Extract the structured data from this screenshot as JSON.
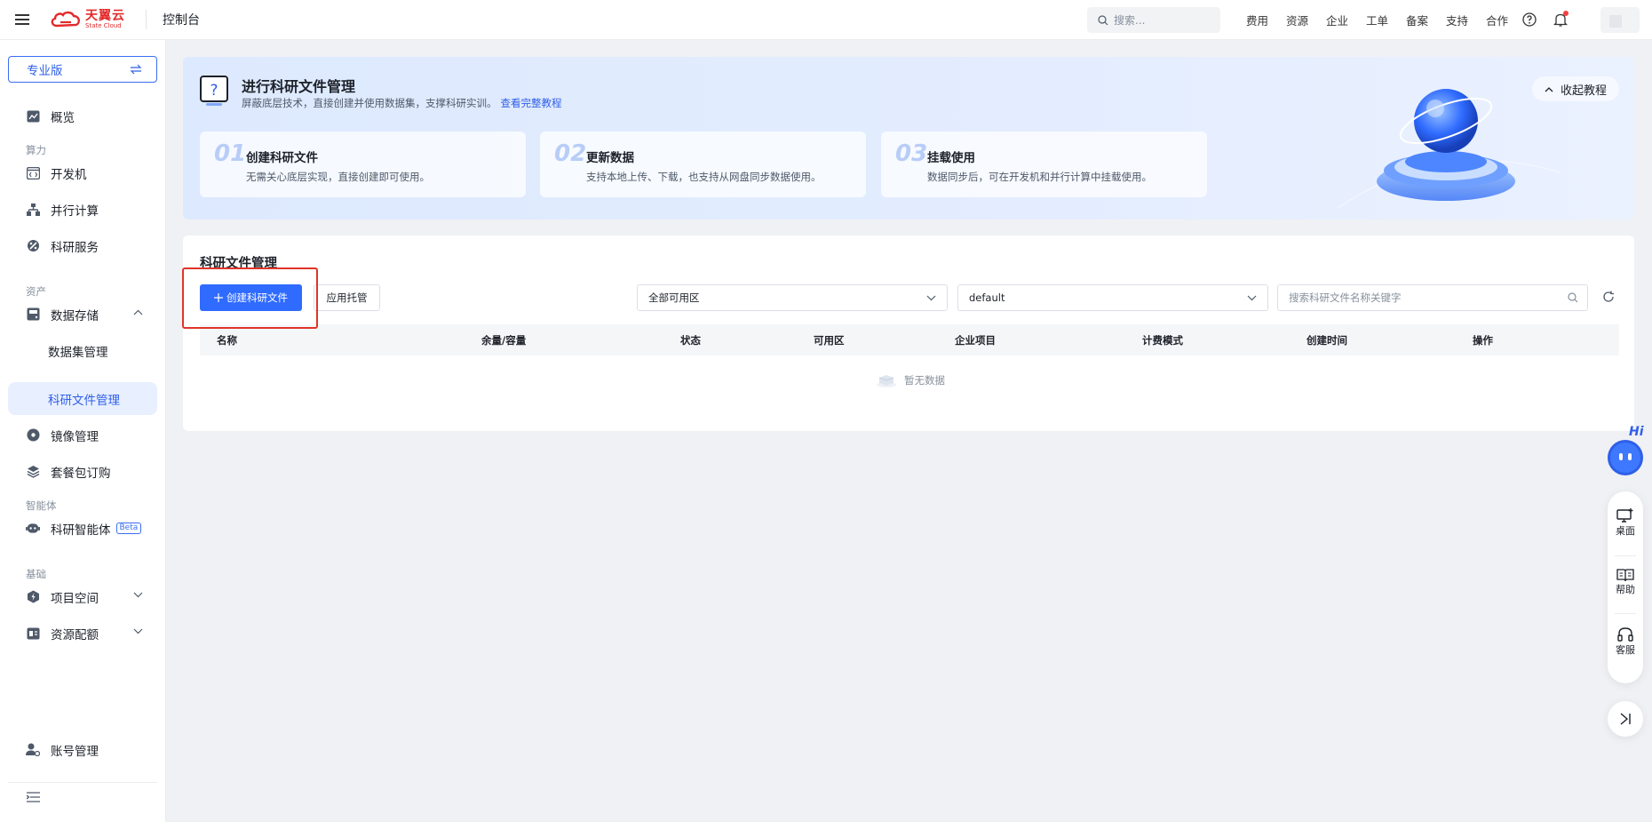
{
  "topbar": {
    "brand_cn": "天翼云",
    "brand_en": "State Cloud",
    "console_title": "控制台",
    "search_placeholder": "搜索...",
    "nav": [
      "费用",
      "资源",
      "企业",
      "工单",
      "备案",
      "支持",
      "合作"
    ]
  },
  "sidebar": {
    "edition_label": "专业版",
    "overview": "概览",
    "group_compute": "算力",
    "dev_machine": "开发机",
    "parallel": "并行计算",
    "research_service": "科研服务",
    "group_assets": "资产",
    "data_storage": "数据存储",
    "dataset_mgmt": "数据集管理",
    "research_file_mgmt": "科研文件管理",
    "image_mgmt": "镜像管理",
    "package_order": "套餐包订购",
    "group_agent": "智能体",
    "research_agent": "科研智能体",
    "beta": "Beta",
    "group_base": "基础",
    "project_space": "项目空间",
    "resource_quota": "资源配额",
    "account_mgmt": "账号管理"
  },
  "banner": {
    "title": "进行科研文件管理",
    "subtitle": "屏蔽底层技术，直接创建并使用数据集，支撑科研实训。",
    "tutorial_link": "查看完整教程",
    "collapse_label": "收起教程",
    "steps": [
      {
        "num": "01",
        "title": "创建科研文件",
        "desc": "无需关心底层实现，直接创建即可使用。"
      },
      {
        "num": "02",
        "title": "更新数据",
        "desc": "支持本地上传、下载，也支持从网盘同步数据使用。"
      },
      {
        "num": "03",
        "title": "挂载使用",
        "desc": "数据同步后，可在开发机和并行计算中挂载使用。"
      }
    ]
  },
  "main": {
    "title": "科研文件管理",
    "create_button": "创建科研文件",
    "app_hosting_button": "应用托管",
    "az_select": "全部可用区",
    "project_select": "default",
    "search_placeholder": "搜索科研文件名称关键字",
    "columns": [
      "名称",
      "余量/容量",
      "状态",
      "可用区",
      "企业项目",
      "计费模式",
      "创建时间",
      "操作"
    ],
    "empty_text": "暂无数据"
  },
  "float": {
    "hi": "Hi",
    "desktop": "桌面",
    "help": "帮助",
    "service": "客服"
  },
  "colors": {
    "primary": "#2f6bff",
    "brand_red": "#e32a2a",
    "highlight_red": "#e0342a"
  }
}
